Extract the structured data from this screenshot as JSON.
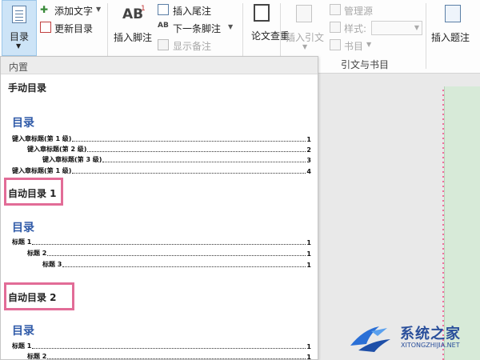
{
  "ribbon": {
    "toc_button": "目录",
    "add_text": "添加文字",
    "update_toc": "更新目录",
    "insert_footnote": "插入脚注",
    "insert_endnote": "插入尾注",
    "next_footnote": "下一条脚注",
    "show_notes": "显示备注",
    "paper_check": "论文查重",
    "insert_citation": "插入引文",
    "manage_sources": "管理源",
    "style_label": "样式:",
    "bibliography": "书目",
    "citations_group": "引文与书目",
    "insert_caption": "插入题注",
    "footnote_icon_text": "AB",
    "footnote_sup": "1"
  },
  "panel": {
    "header": "内置",
    "manual": {
      "label": "手动目录",
      "heading": "目录",
      "rows": [
        {
          "text": "键入章标题(第 1 级)",
          "page": "1"
        },
        {
          "text": "键入章标题(第 2 级)",
          "page": "2"
        },
        {
          "text": "键入章标题(第 3 级)",
          "page": "3"
        },
        {
          "text": "键入章标题(第 1 级)",
          "page": "4"
        }
      ]
    },
    "auto1": {
      "label": "自动目录 1",
      "heading": "目录",
      "rows": [
        {
          "text": "标题 1",
          "page": "1"
        },
        {
          "text": "标题 2",
          "page": "1"
        },
        {
          "text": "标题 3",
          "page": "1"
        }
      ]
    },
    "auto2": {
      "label": "自动目录 2",
      "heading": "目录",
      "rows": [
        {
          "text": "标题 1",
          "page": "1"
        },
        {
          "text": "标题 2",
          "page": "1"
        }
      ]
    }
  },
  "watermark": {
    "title": "系统之家",
    "url": "XITONGZHIJIA.NET"
  },
  "colors": {
    "accent_blue": "#2f5aa8",
    "highlight_pink": "#e26c97",
    "page_green": "#d7ead8"
  }
}
